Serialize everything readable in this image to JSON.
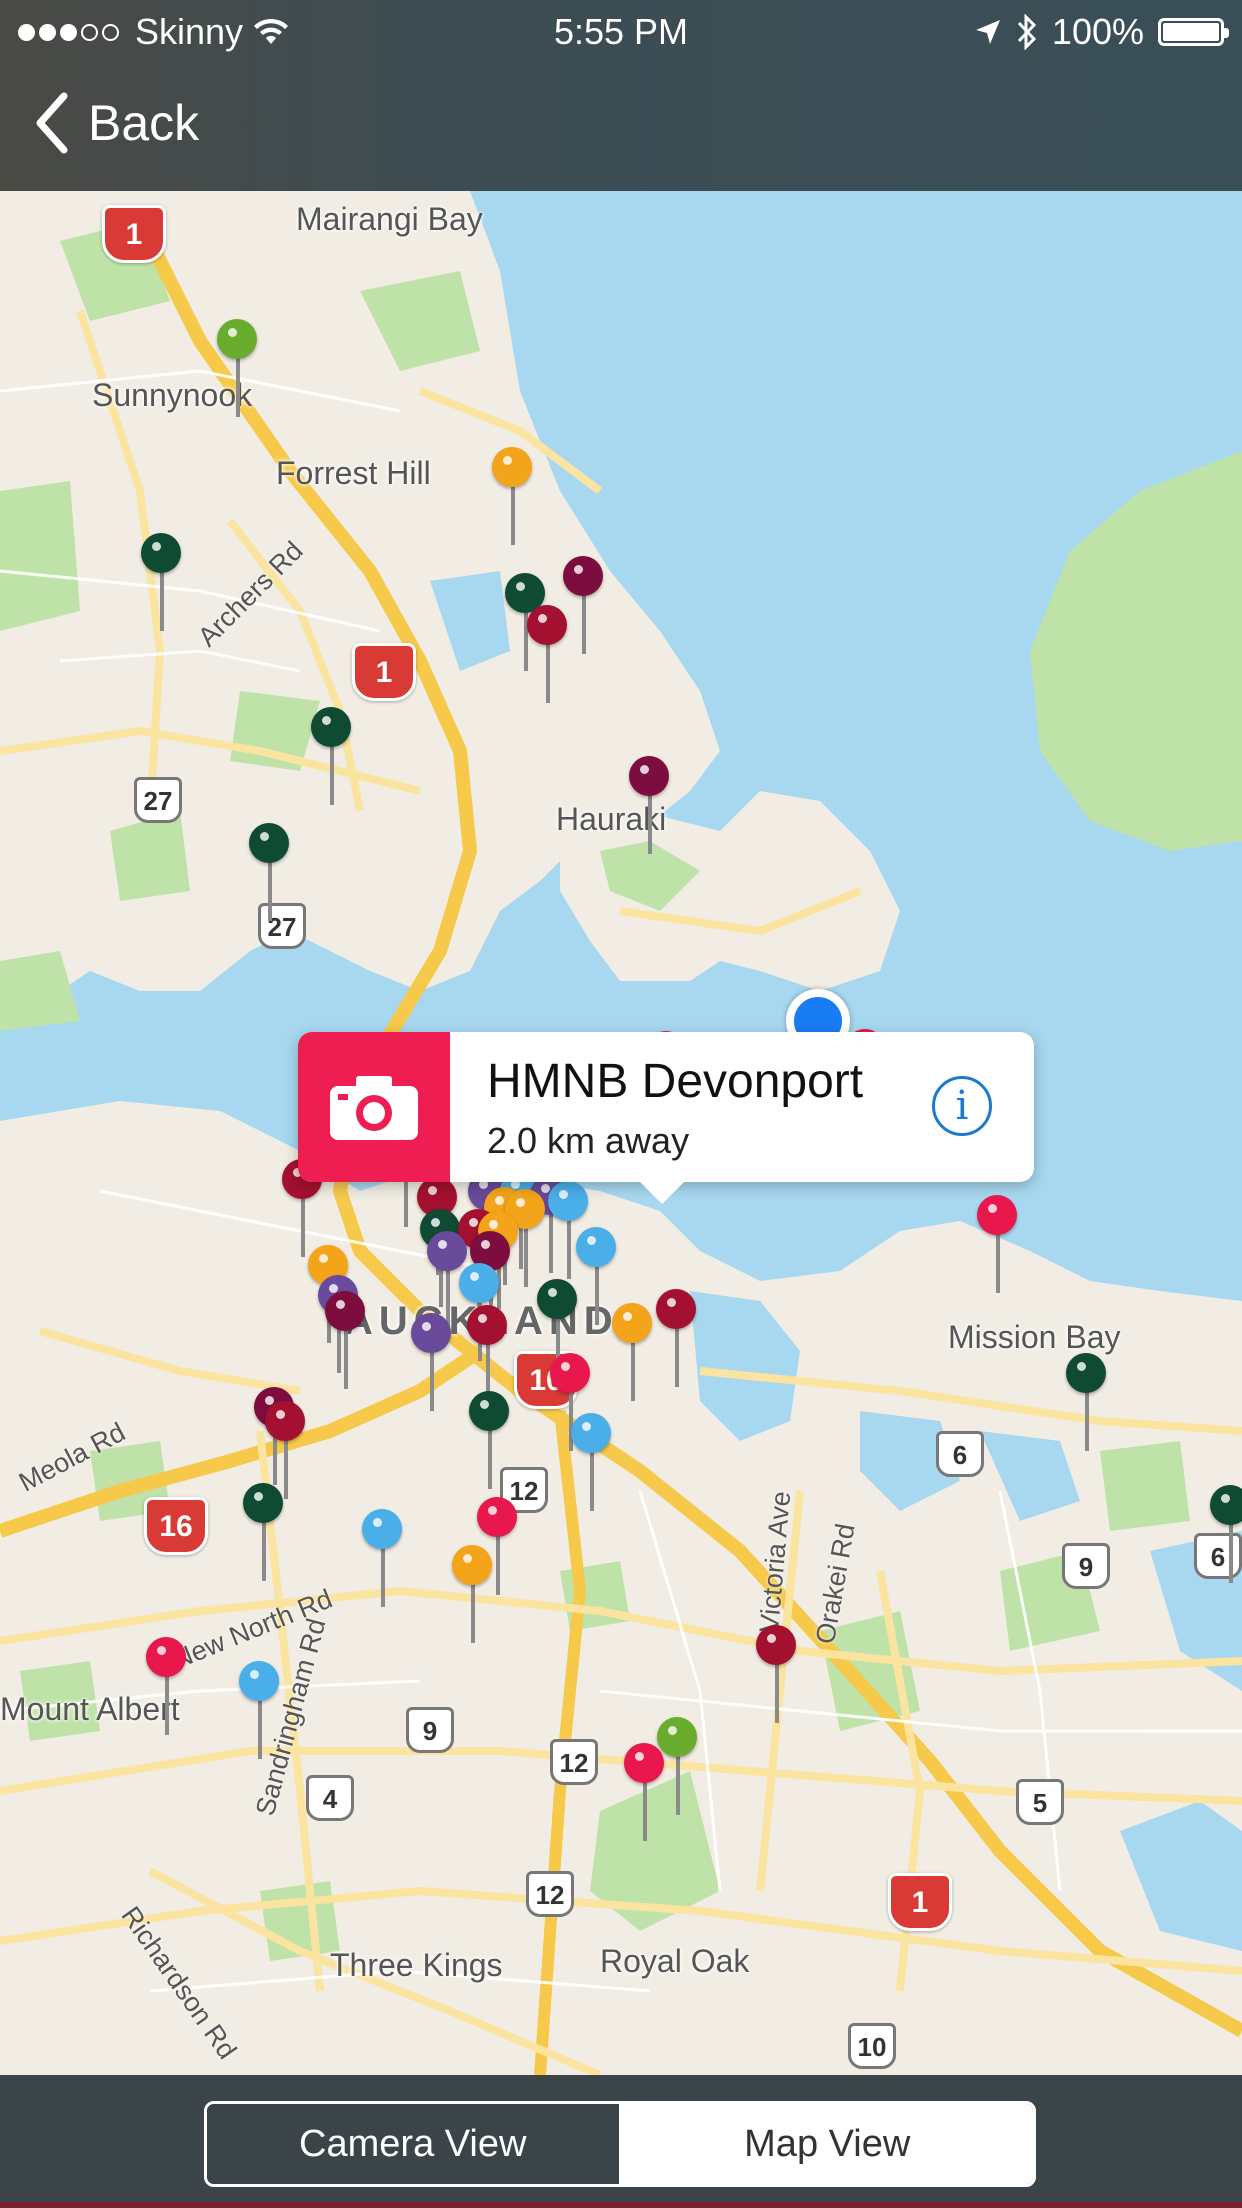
{
  "status_bar": {
    "carrier": "Skinny",
    "time": "5:55 PM",
    "battery": "100%",
    "signal_bars_filled": 3,
    "signal_bars_total": 5
  },
  "nav": {
    "back_label": "Back"
  },
  "map": {
    "place_labels": {
      "mairangi_bay": "Mairangi Bay",
      "sunnynook": "Sunnynook",
      "forrest_hill": "Forrest Hill",
      "hauraki": "Hauraki",
      "auckland": "AUCKLAND",
      "mission_bay": "Mission Bay",
      "mount_albert": "Mount Albert",
      "three_kings": "Three Kings",
      "royal_oak": "Royal Oak"
    },
    "road_labels": {
      "archers_rd": "Archers Rd",
      "meola_rd": "Meola Rd",
      "new_north_rd": "New North Rd",
      "sandringham_rd": "Sandringham Rd",
      "richardson_rd": "Richardson Rd",
      "victoria_ave": "Victoria Ave",
      "orakei_rd": "Orakei Rd"
    },
    "route_shields": {
      "s27a": "27",
      "s27b": "27",
      "s6a": "6",
      "s6b": "6",
      "s9a": "9",
      "s9b": "9",
      "s12a": "12",
      "s12b": "12",
      "s12c": "12",
      "s4": "4",
      "s5": "5",
      "s10": "10"
    },
    "motorway_shields": {
      "m1a": "1",
      "m1b": "1",
      "m1c": "1",
      "m16": "16",
      "m10": "10"
    },
    "pin_colors": {
      "red": "#e8184d",
      "crimson": "#a4102f",
      "maroon": "#7d0d3f",
      "dark_green": "#0f4a33",
      "green": "#6aac2e",
      "orange": "#f3a41a",
      "light_blue": "#4aaee8",
      "purple": "#6a4a9a"
    }
  },
  "callout": {
    "icon": "camera-icon",
    "title": "HMNB Devonport",
    "distance": "2.0 km away",
    "info_icon": "info-icon",
    "info_glyph": "i"
  },
  "segmented_control": {
    "camera_view_label": "Camera View",
    "map_view_label": "Map View",
    "selected": "Camera View"
  }
}
